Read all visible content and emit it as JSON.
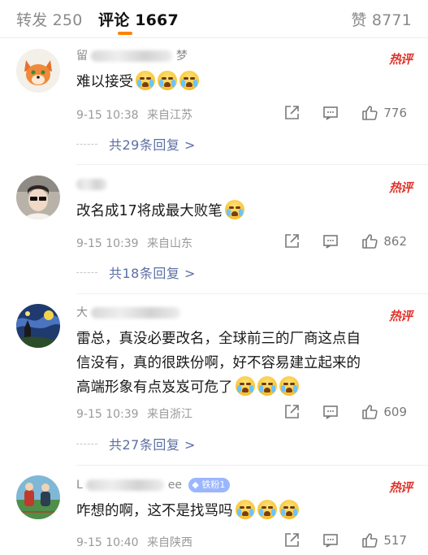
{
  "tabs": {
    "repost": "转发 250",
    "comment": "评论 1667",
    "like": "赞 8771"
  },
  "hot_label": "热评",
  "comments": [
    {
      "name_fragment_a": "留",
      "name_fragment_b": "梦",
      "text": "难以接受",
      "emoji": [
        "cry-emoji",
        "cry-emoji",
        "cry-emoji"
      ],
      "time": "9-15 10:38",
      "location": "来自江苏",
      "likes": "776",
      "replies": "共29条回复 >"
    },
    {
      "name_fragment_a": "",
      "name_fragment_b": "",
      "text": "改名成17将成最大败笔",
      "emoji": [
        "laugh-cry-emoji"
      ],
      "time": "9-15 10:39",
      "location": "来自山东",
      "likes": "862",
      "replies": "共18条回复 >"
    },
    {
      "name_fragment_a": "大",
      "name_fragment_b": "",
      "text_line1": "雷总，真没必要改名，全球前三的厂商这点自",
      "text_line2": "信没有，真的很跌份啊，好不容易建立起来的",
      "text_line3": "高端形象有点岌岌可危了",
      "emoji": [
        "cry-emoji",
        "cry-emoji",
        "cry-emoji"
      ],
      "time": "9-15 10:39",
      "location": "来自浙江",
      "likes": "609",
      "replies": "共27条回复 >"
    },
    {
      "name_fragment_a": "L",
      "name_fragment_b": "ee",
      "fan_badge": "铁粉1",
      "text": "咋想的啊，这不是找骂吗",
      "emoji": [
        "laugh-cry-emoji",
        "laugh-cry-emoji",
        "laugh-cry-emoji"
      ],
      "time": "9-15 10:40",
      "location": "来自陕西",
      "likes": "517"
    }
  ],
  "colors": {
    "accent": "#ff8200",
    "hot": "#e0342c",
    "link": "#5b6fa3",
    "muted": "#9a9a9a"
  }
}
